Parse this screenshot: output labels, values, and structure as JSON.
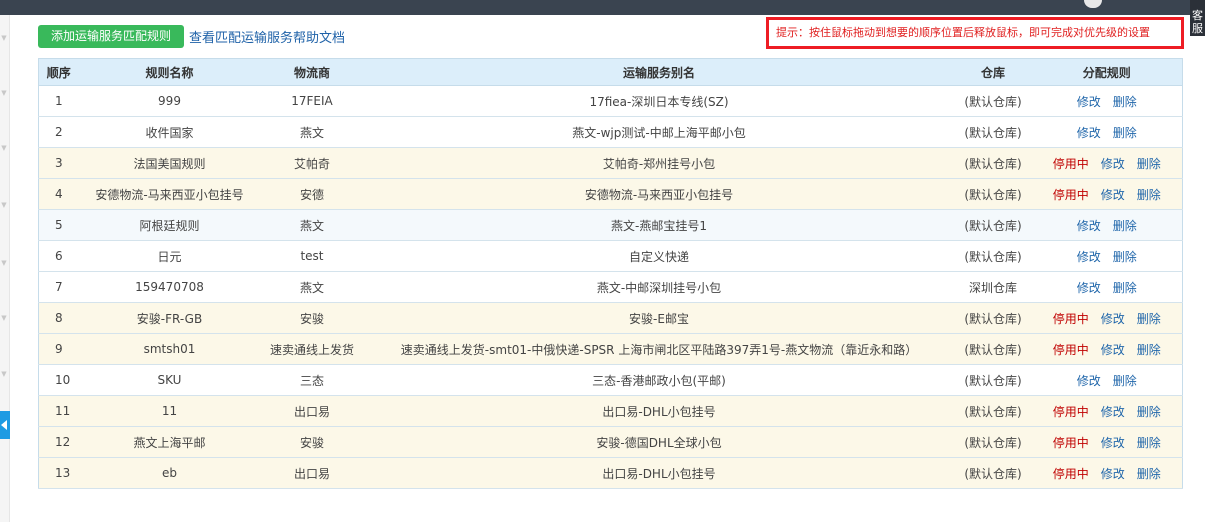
{
  "header": {
    "add_button_label": "添加运输服务匹配规则",
    "help_link_label": "查看匹配运输服务帮助文档",
    "tip_text": "提示：按住鼠标拖动到想要的顺序位置后释放鼠标，即可完成对优先级的设置",
    "service_tab_label": "客服"
  },
  "table": {
    "columns": [
      "顺序",
      "规则名称",
      "物流商",
      "运输服务别名",
      "仓库",
      "分配规则"
    ],
    "action_labels": {
      "edit": "修改",
      "delete": "删除"
    },
    "rows": [
      {
        "order": "1",
        "name": "999",
        "carrier": "17FEIA",
        "alias": "17fiea-深圳日本专线(SZ)",
        "warehouse": "(默认仓库)",
        "status": "",
        "style": "row-plain"
      },
      {
        "order": "2",
        "name": "收件国家",
        "carrier": "燕文",
        "alias": "燕文-wjp测试-中邮上海平邮小包",
        "warehouse": "(默认仓库)",
        "status": "",
        "style": "row-plain"
      },
      {
        "order": "3",
        "name": "法国美国规则",
        "carrier": "艾帕奇",
        "alias": "艾帕奇-郑州挂号小包",
        "warehouse": "(默认仓库)",
        "status": "停用中",
        "style": "row-active"
      },
      {
        "order": "4",
        "name": "安德物流-马来西亚小包挂号",
        "carrier": "安德",
        "alias": "安德物流-马来西亚小包挂号",
        "warehouse": "(默认仓库)",
        "status": "停用中",
        "style": "row-active"
      },
      {
        "order": "5",
        "name": "阿根廷规则",
        "carrier": "燕文",
        "alias": "燕文-燕邮宝挂号1",
        "warehouse": "(默认仓库)",
        "status": "",
        "style": "row-alt"
      },
      {
        "order": "6",
        "name": "日元",
        "carrier": "test",
        "alias": "自定义快递",
        "warehouse": "(默认仓库)",
        "status": "",
        "style": "row-plain"
      },
      {
        "order": "7",
        "name": "159470708",
        "carrier": "燕文",
        "alias": "燕文-中邮深圳挂号小包",
        "warehouse": "深圳仓库",
        "status": "",
        "style": "row-plain"
      },
      {
        "order": "8",
        "name": "安骏-FR-GB",
        "carrier": "安骏",
        "alias": "安骏-E邮宝",
        "warehouse": "(默认仓库)",
        "status": "停用中",
        "style": "row-active"
      },
      {
        "order": "9",
        "name": "smtsh01",
        "carrier": "速卖通线上发货",
        "alias": "速卖通线上发货-smt01-中俄快递-SPSR 上海市闸北区平陆路397弄1号-燕文物流（靠近永和路）",
        "warehouse": "(默认仓库)",
        "status": "停用中",
        "style": "row-active"
      },
      {
        "order": "10",
        "name": "SKU",
        "carrier": "三态",
        "alias": "三态-香港邮政小包(平邮)",
        "warehouse": "(默认仓库)",
        "status": "",
        "style": "row-plain"
      },
      {
        "order": "11",
        "name": "11",
        "carrier": "出口易",
        "alias": "出口易-DHL小包挂号",
        "warehouse": "(默认仓库)",
        "status": "停用中",
        "style": "row-active"
      },
      {
        "order": "12",
        "name": "燕文上海平邮",
        "carrier": "安骏",
        "alias": "安骏-德国DHL全球小包",
        "warehouse": "(默认仓库)",
        "status": "停用中",
        "style": "row-active"
      },
      {
        "order": "13",
        "name": "eb",
        "carrier": "出口易",
        "alias": "出口易-DHL小包挂号",
        "warehouse": "(默认仓库)",
        "status": "停用中",
        "style": "row-active"
      }
    ]
  },
  "colors": {
    "topbar": "#3a4450",
    "add_button": "#39b95b",
    "table_header": "#dceefa",
    "active_row": "#fcf8e8",
    "stop_text": "#c00000",
    "link_text": "#2167ab",
    "tip_border": "#ee1d24"
  },
  "icons": {
    "avatar": "avatar-icon",
    "collapse": "chevron-left-icon",
    "rail": "chevron-down-icon"
  }
}
